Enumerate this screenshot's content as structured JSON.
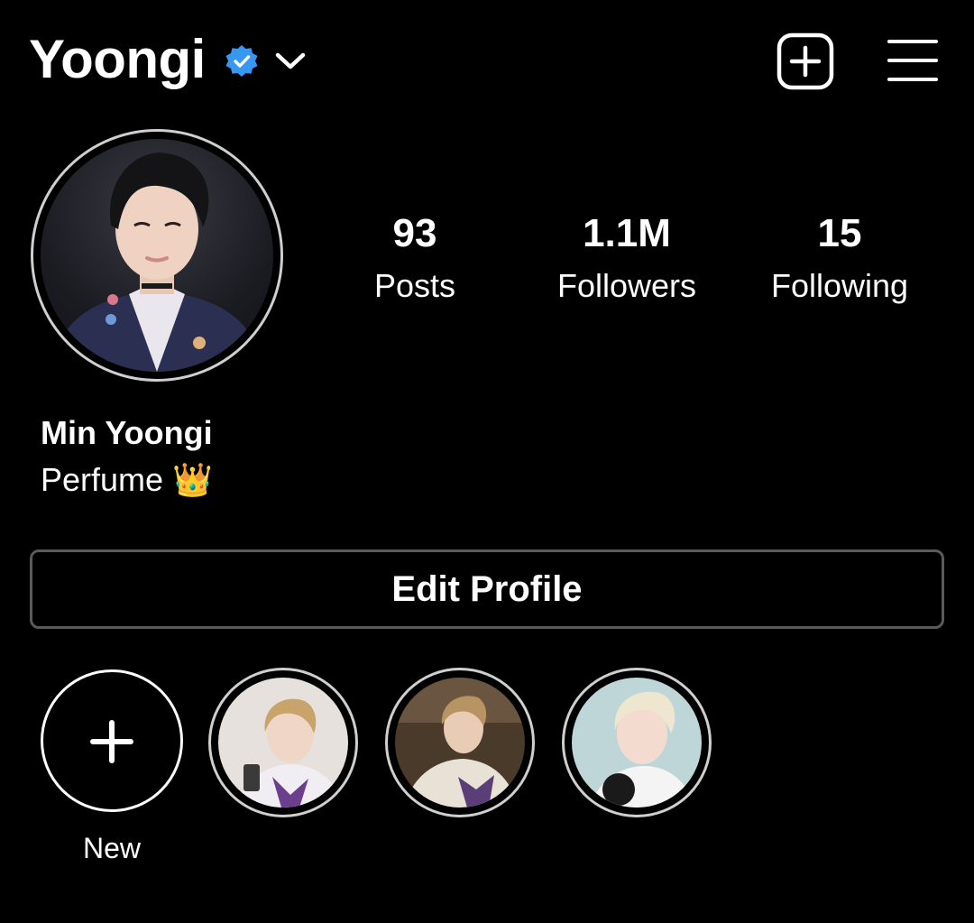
{
  "header": {
    "username": "Yoongi",
    "verified_icon": "verified-badge-icon",
    "chevron_icon": "chevron-down-icon",
    "add_icon": "add-square-icon",
    "menu_icon": "hamburger-menu-icon",
    "verified_color": "#3897f0"
  },
  "profile": {
    "full_name": "Min Yoongi",
    "bio": "Perfume 👑"
  },
  "stats": [
    {
      "value": "93",
      "label": "Posts"
    },
    {
      "value": "1.1M",
      "label": "Followers"
    },
    {
      "value": "15",
      "label": "Following"
    }
  ],
  "actions": {
    "edit_profile_label": "Edit Profile"
  },
  "highlights": {
    "new_label": "New"
  },
  "colors": {
    "background": "#000000",
    "text": "#ffffff",
    "button_border": "#5a5a5a",
    "ring": "#cfcfcf"
  }
}
